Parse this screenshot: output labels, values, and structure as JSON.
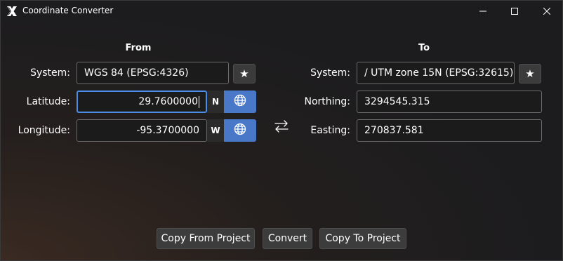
{
  "window": {
    "title": "Coordinate Converter"
  },
  "from": {
    "heading": "From",
    "system_label": "System:",
    "system_value": "WGS 84 (EPSG:4326)",
    "latitude_label": "Latitude:",
    "latitude_value": "29.7600000",
    "latitude_dir": "N",
    "longitude_label": "Longitude:",
    "longitude_value": "-95.3700000",
    "longitude_dir": "W"
  },
  "to": {
    "heading": "To",
    "system_label": "System:",
    "system_value": "/ UTM zone 15N (EPSG:32615)",
    "northing_label": "Northing:",
    "northing_value": "3294545.315",
    "easting_label": "Easting:",
    "easting_value": "270837.581"
  },
  "icons": {
    "favorite": "★",
    "app": "x-logo-icon",
    "globe": "globe-icon",
    "swap": "swap-arrows-icon"
  },
  "buttons": {
    "copy_from_project": "Copy From Project",
    "convert": "Convert",
    "copy_to_project": "Copy To Project"
  },
  "colors": {
    "accent": "#4a78c8",
    "focus_border": "#4c8be6"
  }
}
